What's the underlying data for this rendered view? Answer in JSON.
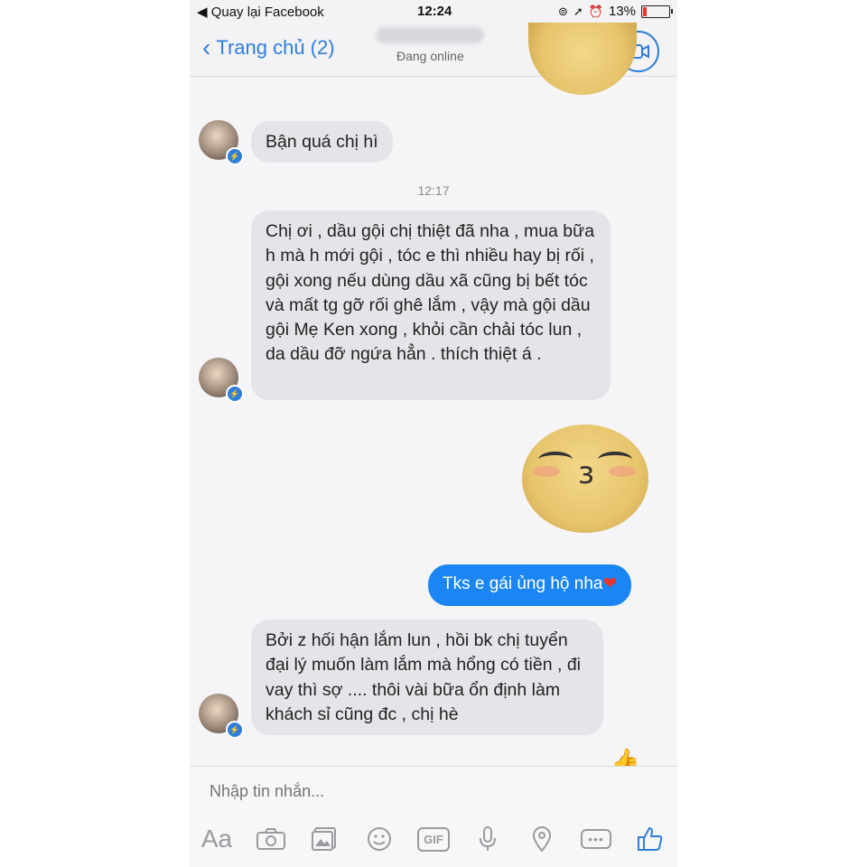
{
  "status_bar": {
    "back_label": "◀ Quay lại Facebook",
    "time": "12:24",
    "battery": "13%",
    "battery_level": 0.13,
    "battery_color": "#e8362f"
  },
  "header": {
    "back_label": "Trang chủ (2)",
    "status": "Đang online",
    "accent": "#2f7fd9"
  },
  "messages": [
    {
      "text": "Bận quá chị hì"
    },
    {
      "timestamp": "12:17"
    },
    {
      "text": "Chị ơi , dầu gội chị thiệt đã nha , mua bữa h mà h mới gội , tóc e thì nhiều hay bị rối , gội xong nếu dùng dầu xã cũng bị bết tóc và mất tg gỡ rối ghê lắm , vậy mà gội dầu gội Mẹ Ken xong , khỏi cần chải tóc lun , da dầu đỡ ngứa hẳn . thích thiệt á ."
    },
    {
      "text": "Tks e gái ủng hộ nha",
      "emoji": "❤"
    },
    {
      "text": "Bởi z hối hận lắm lun , hồi bk chị tuyển đại lý muốn làm lắm mà hổng có tiền , đi vay thì sợ .... thôi vài bữa ổn định làm khách sỉ cũng đc , chị hè"
    }
  ],
  "composer": {
    "placeholder": "Nhập tin nhắn...",
    "tools": [
      "Aa",
      "camera-icon",
      "gallery-icon",
      "emoji-icon",
      "GIF",
      "microphone-icon",
      "location-icon",
      "more-icon",
      "like-icon"
    ]
  },
  "colors": {
    "bubble_in": "#e4e5e8",
    "bubble_out": "#1b86f3"
  }
}
